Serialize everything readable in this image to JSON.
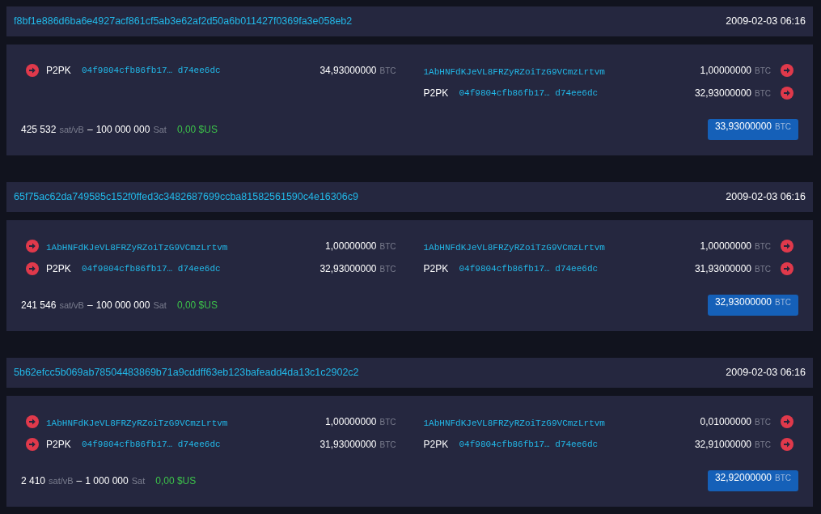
{
  "transactions": [
    {
      "txid": "f8bf1e886d6ba6e4927acf861cf5ab3e62af2d50a6b011427f0369fa3e058eb2",
      "time": "2009-02-03 06:16",
      "inputs": [
        {
          "kind": "p2pk",
          "type": "P2PK",
          "script": "04f9804cfb86fb17… d74ee6dc",
          "amount": "34,93000000",
          "unit": "BTC"
        }
      ],
      "outputs": [
        {
          "kind": "address",
          "address": "1AbHNFdKJeVL8FRZyRZoiTzG9VCmzLrtvm",
          "amount": "1,00000000",
          "unit": "BTC"
        },
        {
          "kind": "p2pk",
          "type": "P2PK",
          "script": "04f9804cfb86fb17… d74ee6dc",
          "amount": "32,93000000",
          "unit": "BTC"
        }
      ],
      "fee": {
        "rate": "425 532",
        "rate_unit": "sat/vB",
        "separator": "–",
        "size": "100 000 000",
        "size_unit": "Sat",
        "fiat": "0,00 $US"
      },
      "total": {
        "amount": "33,93000000",
        "unit": "BTC"
      }
    },
    {
      "txid": "65f75ac62da749585c152f0ffed3c3482687699ccba81582561590c4e16306c9",
      "time": "2009-02-03 06:16",
      "inputs": [
        {
          "kind": "address",
          "address": "1AbHNFdKJeVL8FRZyRZoiTzG9VCmzLrtvm",
          "amount": "1,00000000",
          "unit": "BTC"
        },
        {
          "kind": "p2pk",
          "type": "P2PK",
          "script": "04f9804cfb86fb17… d74ee6dc",
          "amount": "32,93000000",
          "unit": "BTC"
        }
      ],
      "outputs": [
        {
          "kind": "address",
          "address": "1AbHNFdKJeVL8FRZyRZoiTzG9VCmzLrtvm",
          "amount": "1,00000000",
          "unit": "BTC"
        },
        {
          "kind": "p2pk",
          "type": "P2PK",
          "script": "04f9804cfb86fb17… d74ee6dc",
          "amount": "31,93000000",
          "unit": "BTC"
        }
      ],
      "fee": {
        "rate": "241 546",
        "rate_unit": "sat/vB",
        "separator": "–",
        "size": "100 000 000",
        "size_unit": "Sat",
        "fiat": "0,00 $US"
      },
      "total": {
        "amount": "32,93000000",
        "unit": "BTC"
      }
    },
    {
      "txid": "5b62efcc5b069ab78504483869b71a9cddff63eb123bafeadd4da13c1c2902c2",
      "time": "2009-02-03 06:16",
      "inputs": [
        {
          "kind": "address",
          "address": "1AbHNFdKJeVL8FRZyRZoiTzG9VCmzLrtvm",
          "amount": "1,00000000",
          "unit": "BTC"
        },
        {
          "kind": "p2pk",
          "type": "P2PK",
          "script": "04f9804cfb86fb17… d74ee6dc",
          "amount": "31,93000000",
          "unit": "BTC"
        }
      ],
      "outputs": [
        {
          "kind": "address",
          "address": "1AbHNFdKJeVL8FRZyRZoiTzG9VCmzLrtvm",
          "amount": "0,01000000",
          "unit": "BTC"
        },
        {
          "kind": "p2pk",
          "type": "P2PK",
          "script": "04f9804cfb86fb17… d74ee6dc",
          "amount": "32,91000000",
          "unit": "BTC"
        }
      ],
      "fee": {
        "rate": "2 410",
        "rate_unit": "sat/vB",
        "separator": "–",
        "size": "1 000 000",
        "size_unit": "Sat",
        "fiat": "0,00 $US"
      },
      "total": {
        "amount": "32,92000000",
        "unit": "BTC"
      }
    }
  ]
}
